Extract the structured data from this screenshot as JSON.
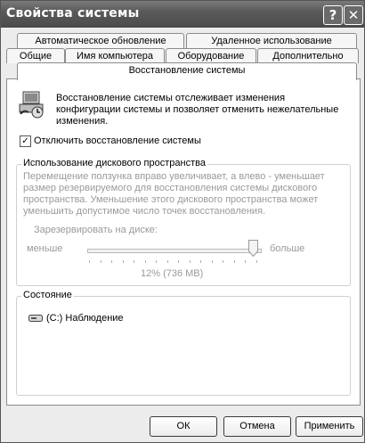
{
  "window": {
    "title": "Свойства системы",
    "help_label": "?",
    "close_label": "✕"
  },
  "tabs": {
    "row1": [
      "Автоматическое обновление",
      "Удаленное использование"
    ],
    "row2": [
      "Общие",
      "Имя компьютера",
      "Оборудование",
      "Дополнительно"
    ],
    "active": "Восстановление системы"
  },
  "panel": {
    "intro_lines": [
      "Восстановление системы отслеживает изменения",
      "конфигурации системы и позволяет отменить нежелательные",
      "изменения."
    ],
    "checkbox_label": "Отключить восстановление системы",
    "checkbox_checked": true,
    "disk_group": {
      "title": "Использование дискового пространства",
      "description_lines": [
        "Перемещение ползунка вправо увеличивает, а влево - уменьшает",
        "размер резервируемого для восстановления системы дискового",
        "пространства. Уменьшение этого дискового пространства может",
        "уменьшить допустимое число точек восстановления."
      ],
      "reserve_label": "Зарезервировать на диске:",
      "min_label": "меньше",
      "max_label": "больше",
      "slider_value_text": "12% (736 MB)",
      "slider_fraction": 0.96
    },
    "status_group": {
      "title": "Состояние",
      "drive_text": "(C:) Наблюдение"
    }
  },
  "buttons": {
    "ok": "ОК",
    "cancel": "Отмена",
    "apply": "Применить"
  },
  "icons": {
    "window": [
      "help-icon",
      "close-icon"
    ],
    "panel": [
      "system-restore-icon",
      "hard-drive-icon"
    ]
  }
}
